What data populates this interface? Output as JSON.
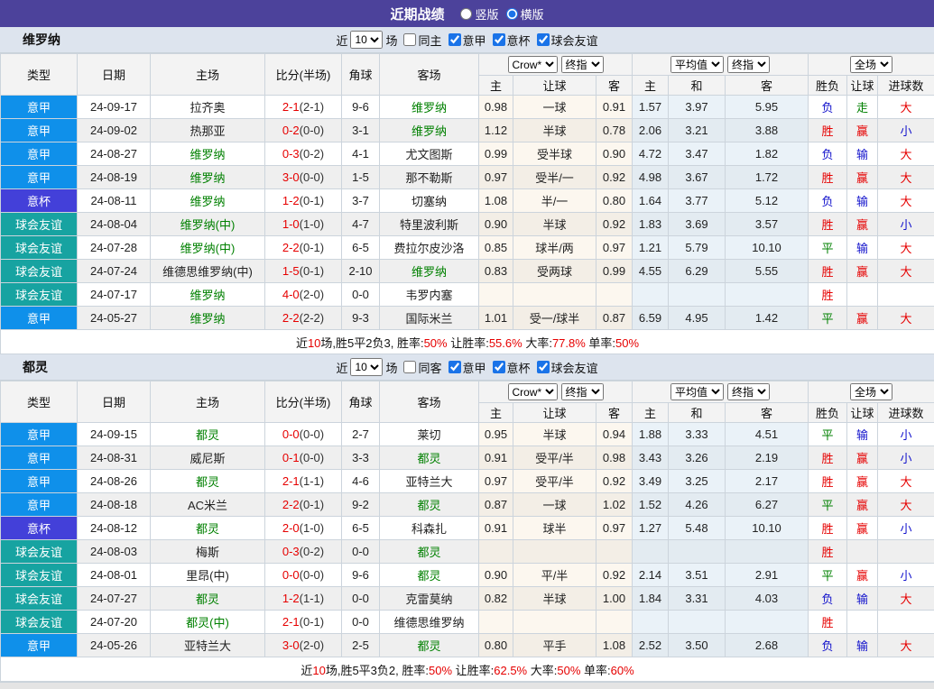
{
  "title_bar": {
    "title": "近期战绩",
    "layout_options": [
      {
        "label": "竖版",
        "checked": false
      },
      {
        "label": "横版",
        "checked": true
      }
    ]
  },
  "table_header": {
    "cols": [
      "类型",
      "日期",
      "主场",
      "比分(半场)",
      "角球",
      "客场"
    ],
    "odds_source_select": "Crow*",
    "odds_final_select": "终指",
    "avg_source_select": "平均值",
    "avg_final_select": "终指",
    "scope_select": "全场",
    "odds_sub": [
      "主",
      "让球",
      "客"
    ],
    "avg_sub": [
      "主",
      "和",
      "客"
    ],
    "result_sub": [
      "胜负",
      "让球",
      "进球数"
    ]
  },
  "colors": {
    "league_types": {
      "意甲": "#0f90ea",
      "意杯": "#4340d9",
      "球会友谊": "#17a3a1"
    },
    "results": {
      "胜": "#e60000",
      "赢": "#e60000",
      "大": "#e60000",
      "负": "#1212cc",
      "输": "#1212cc",
      "小": "#1212cc",
      "平": "#008000",
      "走": "#008000"
    },
    "focus_team": "#008000",
    "score": "#e60000",
    "accent": "#4c429b"
  },
  "sections": [
    {
      "team": "维罗纳",
      "filter": {
        "near_label": "近",
        "count": "10",
        "games_label": "场",
        "same": {
          "label": "同主",
          "checked": false
        },
        "leagues": [
          {
            "label": "意甲",
            "checked": true
          },
          {
            "label": "意杯",
            "checked": true
          },
          {
            "label": "球会友谊",
            "checked": true
          }
        ]
      },
      "rows": [
        {
          "type": "意甲",
          "date": "24-09-17",
          "home": "拉齐奥",
          "home_focus": false,
          "score": "2-1",
          "half": "(2-1)",
          "corner": "9-6",
          "away": "维罗纳",
          "away_focus": true,
          "odds": [
            "0.98",
            "一球",
            "0.91"
          ],
          "avg": [
            "1.57",
            "3.97",
            "5.95"
          ],
          "results": [
            "负",
            "走",
            "大"
          ]
        },
        {
          "type": "意甲",
          "date": "24-09-02",
          "home": "热那亚",
          "home_focus": false,
          "score": "0-2",
          "half": "(0-0)",
          "corner": "3-1",
          "away": "维罗纳",
          "away_focus": true,
          "odds": [
            "1.12",
            "半球",
            "0.78"
          ],
          "avg": [
            "2.06",
            "3.21",
            "3.88"
          ],
          "results": [
            "胜",
            "赢",
            "小"
          ]
        },
        {
          "type": "意甲",
          "date": "24-08-27",
          "home": "维罗纳",
          "home_focus": true,
          "score": "0-3",
          "half": "(0-2)",
          "corner": "4-1",
          "away": "尤文图斯",
          "away_focus": false,
          "odds": [
            "0.99",
            "受半球",
            "0.90"
          ],
          "avg": [
            "4.72",
            "3.47",
            "1.82"
          ],
          "results": [
            "负",
            "输",
            "大"
          ]
        },
        {
          "type": "意甲",
          "date": "24-08-19",
          "home": "维罗纳",
          "home_focus": true,
          "score": "3-0",
          "half": "(0-0)",
          "corner": "1-5",
          "away": "那不勒斯",
          "away_focus": false,
          "odds": [
            "0.97",
            "受半/一",
            "0.92"
          ],
          "avg": [
            "4.98",
            "3.67",
            "1.72"
          ],
          "results": [
            "胜",
            "赢",
            "大"
          ]
        },
        {
          "type": "意杯",
          "date": "24-08-11",
          "home": "维罗纳",
          "home_focus": true,
          "score": "1-2",
          "half": "(0-1)",
          "corner": "3-7",
          "away": "切塞纳",
          "away_focus": false,
          "odds": [
            "1.08",
            "半/一",
            "0.80"
          ],
          "avg": [
            "1.64",
            "3.77",
            "5.12"
          ],
          "results": [
            "负",
            "输",
            "大"
          ]
        },
        {
          "type": "球会友谊",
          "date": "24-08-04",
          "home": "维罗纳(中)",
          "home_focus": true,
          "score": "1-0",
          "half": "(1-0)",
          "corner": "4-7",
          "away": "特里波利斯",
          "away_focus": false,
          "odds": [
            "0.90",
            "半球",
            "0.92"
          ],
          "avg": [
            "1.83",
            "3.69",
            "3.57"
          ],
          "results": [
            "胜",
            "赢",
            "小"
          ]
        },
        {
          "type": "球会友谊",
          "date": "24-07-28",
          "home": "维罗纳(中)",
          "home_focus": true,
          "score": "2-2",
          "half": "(0-1)",
          "corner": "6-5",
          "away": "费拉尔皮沙洛",
          "away_focus": false,
          "odds": [
            "0.85",
            "球半/两",
            "0.97"
          ],
          "avg": [
            "1.21",
            "5.79",
            "10.10"
          ],
          "results": [
            "平",
            "输",
            "大"
          ]
        },
        {
          "type": "球会友谊",
          "date": "24-07-24",
          "home": "维德思维罗纳(中)",
          "home_focus": false,
          "score": "1-5",
          "half": "(0-1)",
          "corner": "2-10",
          "away": "维罗纳",
          "away_focus": true,
          "odds": [
            "0.83",
            "受两球",
            "0.99"
          ],
          "avg": [
            "4.55",
            "6.29",
            "5.55"
          ],
          "results": [
            "胜",
            "赢",
            "大"
          ]
        },
        {
          "type": "球会友谊",
          "date": "24-07-17",
          "home": "维罗纳",
          "home_focus": true,
          "score": "4-0",
          "half": "(2-0)",
          "corner": "0-0",
          "away": "韦罗内塞",
          "away_focus": false,
          "odds": [
            "",
            "",
            ""
          ],
          "avg": [
            "",
            "",
            ""
          ],
          "results": [
            "胜",
            "",
            ""
          ]
        },
        {
          "type": "意甲",
          "date": "24-05-27",
          "home": "维罗纳",
          "home_focus": true,
          "score": "2-2",
          "half": "(2-2)",
          "corner": "9-3",
          "away": "国际米兰",
          "away_focus": false,
          "odds": [
            "1.01",
            "受一/球半",
            "0.87"
          ],
          "avg": [
            "6.59",
            "4.95",
            "1.42"
          ],
          "results": [
            "平",
            "赢",
            "大"
          ]
        }
      ],
      "summary": [
        {
          "text": "近",
          "red": false
        },
        {
          "text": "10",
          "red": true
        },
        {
          "text": "场,胜5平2负3, 胜率:",
          "red": false
        },
        {
          "text": "50%",
          "red": true
        },
        {
          "text": " 让胜率:",
          "red": false
        },
        {
          "text": "55.6%",
          "red": true
        },
        {
          "text": " 大率:",
          "red": false
        },
        {
          "text": "77.8%",
          "red": true
        },
        {
          "text": " 单率:",
          "red": false
        },
        {
          "text": "50%",
          "red": true
        }
      ]
    },
    {
      "team": "都灵",
      "filter": {
        "near_label": "近",
        "count": "10",
        "games_label": "场",
        "same": {
          "label": "同客",
          "checked": false
        },
        "leagues": [
          {
            "label": "意甲",
            "checked": true
          },
          {
            "label": "意杯",
            "checked": true
          },
          {
            "label": "球会友谊",
            "checked": true
          }
        ]
      },
      "rows": [
        {
          "type": "意甲",
          "date": "24-09-15",
          "home": "都灵",
          "home_focus": true,
          "score": "0-0",
          "half": "(0-0)",
          "corner": "2-7",
          "away": "莱切",
          "away_focus": false,
          "odds": [
            "0.95",
            "半球",
            "0.94"
          ],
          "avg": [
            "1.88",
            "3.33",
            "4.51"
          ],
          "results": [
            "平",
            "输",
            "小"
          ]
        },
        {
          "type": "意甲",
          "date": "24-08-31",
          "home": "威尼斯",
          "home_focus": false,
          "score": "0-1",
          "half": "(0-0)",
          "corner": "3-3",
          "away": "都灵",
          "away_focus": true,
          "odds": [
            "0.91",
            "受平/半",
            "0.98"
          ],
          "avg": [
            "3.43",
            "3.26",
            "2.19"
          ],
          "results": [
            "胜",
            "赢",
            "小"
          ]
        },
        {
          "type": "意甲",
          "date": "24-08-26",
          "home": "都灵",
          "home_focus": true,
          "score": "2-1",
          "half": "(1-1)",
          "corner": "4-6",
          "away": "亚特兰大",
          "away_focus": false,
          "odds": [
            "0.97",
            "受平/半",
            "0.92"
          ],
          "avg": [
            "3.49",
            "3.25",
            "2.17"
          ],
          "results": [
            "胜",
            "赢",
            "大"
          ]
        },
        {
          "type": "意甲",
          "date": "24-08-18",
          "home": "AC米兰",
          "home_focus": false,
          "score": "2-2",
          "half": "(0-1)",
          "corner": "9-2",
          "away": "都灵",
          "away_focus": true,
          "odds": [
            "0.87",
            "一球",
            "1.02"
          ],
          "avg": [
            "1.52",
            "4.26",
            "6.27"
          ],
          "results": [
            "平",
            "赢",
            "大"
          ]
        },
        {
          "type": "意杯",
          "date": "24-08-12",
          "home": "都灵",
          "home_focus": true,
          "score": "2-0",
          "half": "(1-0)",
          "corner": "6-5",
          "away": "科森扎",
          "away_focus": false,
          "odds": [
            "0.91",
            "球半",
            "0.97"
          ],
          "avg": [
            "1.27",
            "5.48",
            "10.10"
          ],
          "results": [
            "胜",
            "赢",
            "小"
          ]
        },
        {
          "type": "球会友谊",
          "date": "24-08-03",
          "home": "梅斯",
          "home_focus": false,
          "score": "0-3",
          "half": "(0-2)",
          "corner": "0-0",
          "away": "都灵",
          "away_focus": true,
          "odds": [
            "",
            "",
            ""
          ],
          "avg": [
            "",
            "",
            ""
          ],
          "results": [
            "胜",
            "",
            ""
          ]
        },
        {
          "type": "球会友谊",
          "date": "24-08-01",
          "home": "里昂(中)",
          "home_focus": false,
          "score": "0-0",
          "half": "(0-0)",
          "corner": "9-6",
          "away": "都灵",
          "away_focus": true,
          "odds": [
            "0.90",
            "平/半",
            "0.92"
          ],
          "avg": [
            "2.14",
            "3.51",
            "2.91"
          ],
          "results": [
            "平",
            "赢",
            "小"
          ]
        },
        {
          "type": "球会友谊",
          "date": "24-07-27",
          "home": "都灵",
          "home_focus": true,
          "score": "1-2",
          "half": "(1-1)",
          "corner": "0-0",
          "away": "克雷莫纳",
          "away_focus": false,
          "odds": [
            "0.82",
            "半球",
            "1.00"
          ],
          "avg": [
            "1.84",
            "3.31",
            "4.03"
          ],
          "results": [
            "负",
            "输",
            "大"
          ]
        },
        {
          "type": "球会友谊",
          "date": "24-07-20",
          "home": "都灵(中)",
          "home_focus": true,
          "score": "2-1",
          "half": "(0-1)",
          "corner": "0-0",
          "away": "维德思维罗纳",
          "away_focus": false,
          "odds": [
            "",
            "",
            ""
          ],
          "avg": [
            "",
            "",
            ""
          ],
          "results": [
            "胜",
            "",
            ""
          ]
        },
        {
          "type": "意甲",
          "date": "24-05-26",
          "home": "亚特兰大",
          "home_focus": false,
          "score": "3-0",
          "half": "(2-0)",
          "corner": "2-5",
          "away": "都灵",
          "away_focus": true,
          "odds": [
            "0.80",
            "平手",
            "1.08"
          ],
          "avg": [
            "2.52",
            "3.50",
            "2.68"
          ],
          "results": [
            "负",
            "输",
            "大"
          ]
        }
      ],
      "summary": [
        {
          "text": "近",
          "red": false
        },
        {
          "text": "10",
          "red": true
        },
        {
          "text": "场,胜5平3负2, 胜率:",
          "red": false
        },
        {
          "text": "50%",
          "red": true
        },
        {
          "text": " 让胜率:",
          "red": false
        },
        {
          "text": "62.5%",
          "red": true
        },
        {
          "text": " 大率:",
          "red": false
        },
        {
          "text": "50%",
          "red": true
        },
        {
          "text": " 单率:",
          "red": false
        },
        {
          "text": "60%",
          "red": true
        }
      ]
    }
  ]
}
